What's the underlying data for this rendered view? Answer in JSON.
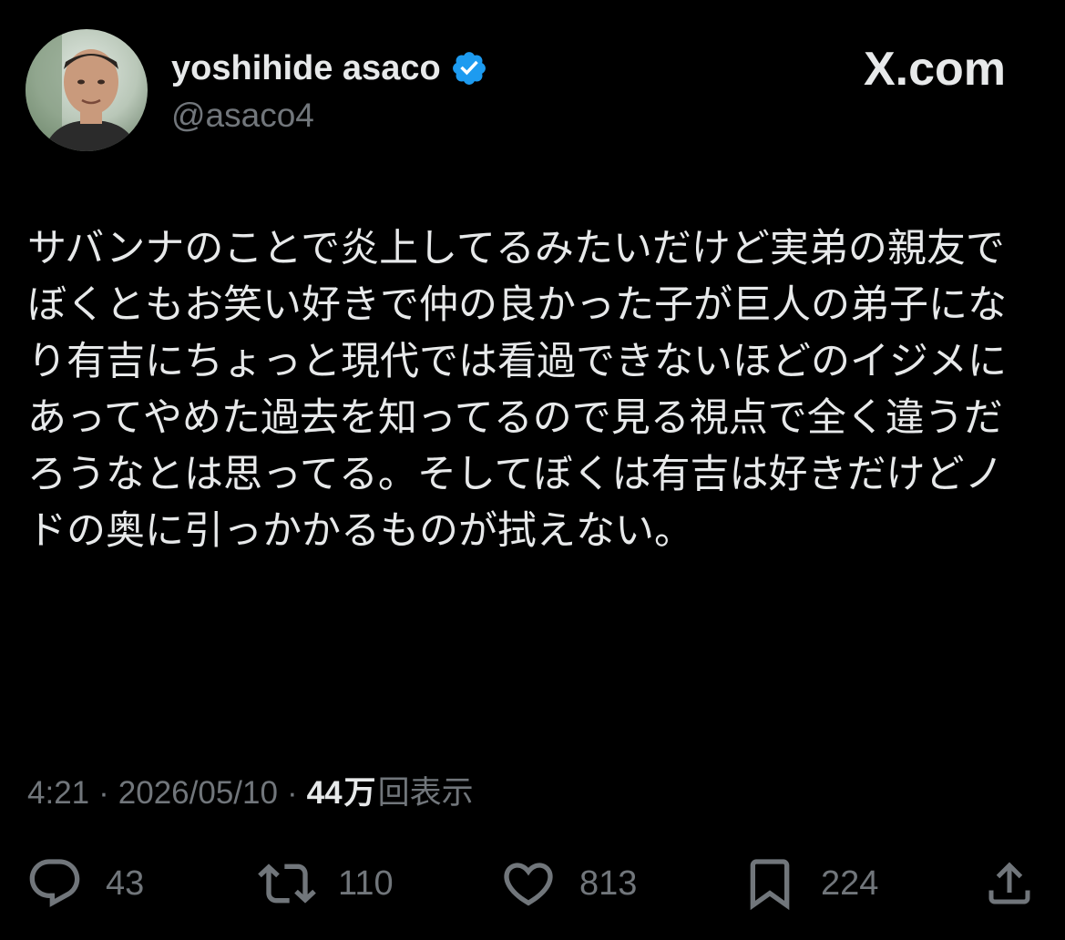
{
  "author": {
    "display_name": "yoshihide asaco",
    "handle": "@asaco4",
    "verified": true,
    "avatar_icon": "avatar-photo"
  },
  "brand": {
    "text": "X.com",
    "logo_icon": "x-logo-icon"
  },
  "tweet": {
    "text": "サバンナのことで炎上してるみたいだけど実弟の親友でぼくともお笑い好きで仲の良かった子が巨人の弟子になり有吉にちょっと現代では看過できないほどのイジメにあってやめた過去を知ってるので見る視点で全く違うだろうなとは思ってる。そしてぼくは有吉は好きだけどノドの奥に引っかかるものが拭えない。"
  },
  "meta": {
    "time": "4:21",
    "separator": "·",
    "date": "2026/05/10",
    "views_count": "44",
    "views_unit": "万",
    "views_label": "回表示"
  },
  "actions": {
    "reply_count": "43",
    "retweet_count": "110",
    "like_count": "813",
    "bookmark_count": "224"
  },
  "colors": {
    "background": "#000000",
    "text": "#e7e9ea",
    "muted": "#71767b",
    "verified": "#1d9bf0"
  }
}
